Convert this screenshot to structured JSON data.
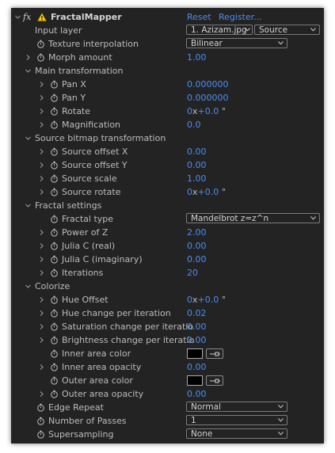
{
  "effect": {
    "fx": "fx",
    "name": "FractalMapper",
    "reset": "Reset",
    "register": "Register..."
  },
  "input_layer": {
    "label": "Input layer",
    "layer_value": "1. Azizam.jpg",
    "source_value": "Source"
  },
  "texture_interpolation": {
    "label": "Texture interpolation",
    "value": "Bilinear"
  },
  "morph_amount": {
    "label": "Morph amount",
    "value": "1.00"
  },
  "main_transformation": {
    "label": "Main transformation",
    "pan_x": {
      "label": "Pan X",
      "value": "0.000000"
    },
    "pan_y": {
      "label": "Pan Y",
      "value": "0.000000"
    },
    "rotate": {
      "label": "Rotate",
      "revs": "0",
      "unit": "x",
      "deg": "+0.0",
      "deg_sym": "°"
    },
    "magnification": {
      "label": "Magnification",
      "value": "0.0"
    }
  },
  "source_bitmap": {
    "label": "Source bitmap transformation",
    "offset_x": {
      "label": "Source offset X",
      "value": "0.00"
    },
    "offset_y": {
      "label": "Source offset Y",
      "value": "0.00"
    },
    "scale": {
      "label": "Source scale",
      "value": "1.00"
    },
    "rotate": {
      "label": "Source rotate",
      "revs": "0",
      "unit": "x",
      "deg": "+0.0",
      "deg_sym": "°"
    }
  },
  "fractal_settings": {
    "label": "Fractal settings",
    "fractal_type": {
      "label": "Fractal type",
      "value": "Mandelbrot z=z^n"
    },
    "power_of_z": {
      "label": "Power of Z",
      "value": "2.00"
    },
    "julia_real": {
      "label": "Julia C (real)",
      "value": "0.00"
    },
    "julia_imag": {
      "label": "Julia C (imaginary)",
      "value": "0.00"
    },
    "iterations": {
      "label": "Iterations",
      "value": "20"
    }
  },
  "colorize": {
    "label": "Colorize",
    "hue_offset": {
      "label": "Hue Offset",
      "revs": "0",
      "unit": "x",
      "deg": "+0.0",
      "deg_sym": "°"
    },
    "hue_change": {
      "label": "Hue change per iteration",
      "value": "0.02"
    },
    "sat_change": {
      "label": "Saturation change per iteratio",
      "value": "0.00"
    },
    "bright_change": {
      "label": "Brightness change per iteratio",
      "value": "0.00"
    },
    "inner_color": {
      "label": "Inner area color",
      "color": "#000000"
    },
    "inner_opacity": {
      "label": "Inner area opacity",
      "value": "0.00"
    },
    "outer_color": {
      "label": "Outer area color",
      "color": "#000000"
    },
    "outer_opacity": {
      "label": "Outer area opacity",
      "value": "0.00"
    }
  },
  "edge_repeat": {
    "label": "Edge Repeat",
    "value": "Normal"
  },
  "passes": {
    "label": "Number of Passes",
    "value": "1"
  },
  "supersampling": {
    "label": "Supersampling",
    "value": "None"
  },
  "colors": {
    "panel_bg": "#232323",
    "text": "#bcbcbc",
    "value_blue": "#4a8ef0",
    "warning": "#f5c400"
  }
}
